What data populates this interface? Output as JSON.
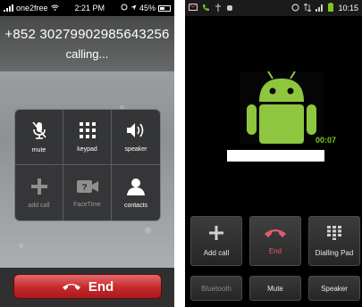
{
  "ios": {
    "status": {
      "carrier": "one2free",
      "time": "2:21 PM",
      "battery": "45%"
    },
    "call": {
      "number": "+852 30279902985643256",
      "state": "calling..."
    },
    "buttons": [
      {
        "label": "mute",
        "icon": "mic-off-icon"
      },
      {
        "label": "keypad",
        "icon": "keypad-grid-icon"
      },
      {
        "label": "speaker",
        "icon": "speaker-icon"
      },
      {
        "label": "add call",
        "icon": "plus-icon"
      },
      {
        "label": "FaceTime",
        "icon": "facetime-icon"
      },
      {
        "label": "contacts",
        "icon": "person-icon"
      }
    ],
    "end_label": "End",
    "colors": {
      "end": "#c5292b"
    }
  },
  "android": {
    "status": {
      "time": "10:15"
    },
    "call": {
      "duration": "00:07"
    },
    "buttons": [
      {
        "label": "Add call",
        "icon": "plus-icon"
      },
      {
        "label": "End",
        "icon": "end-call-icon"
      },
      {
        "label": "Dialling Pad",
        "icon": "dialpad-icon"
      }
    ],
    "toggles": [
      {
        "label": "Bluetooth",
        "enabled": false
      },
      {
        "label": "Mute",
        "enabled": true
      },
      {
        "label": "Speaker",
        "enabled": true
      }
    ],
    "colors": {
      "accent": "#7cc61f",
      "end": "#e85a6a"
    }
  }
}
